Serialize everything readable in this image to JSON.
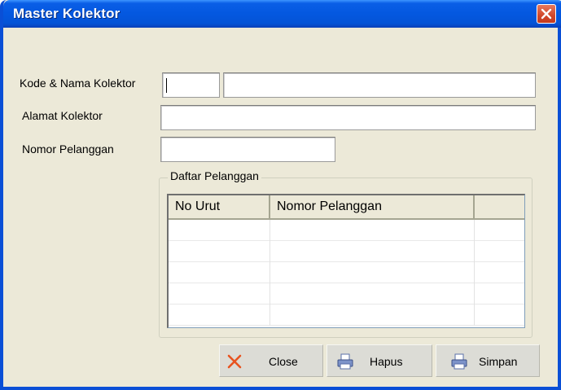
{
  "window": {
    "title": "Master Kolektor"
  },
  "form": {
    "kode_nama_label": "Kode & Nama Kolektor",
    "kode_value": "",
    "nama_value": "",
    "alamat_label": "Alamat Kolektor",
    "alamat_value": "",
    "nomor_pelanggan_label": "Nomor Pelanggan",
    "nomor_pelanggan_value": ""
  },
  "daftar": {
    "title": "Daftar Pelanggan",
    "columns": [
      "No Urut",
      "Nomor Pelanggan",
      ""
    ],
    "rows": [
      [
        "",
        "",
        ""
      ],
      [
        "",
        "",
        ""
      ],
      [
        "",
        "",
        ""
      ],
      [
        "",
        "",
        ""
      ],
      [
        "",
        "",
        ""
      ]
    ]
  },
  "buttons": {
    "close_label": "Close",
    "hapus_label": "Hapus",
    "simpan_label": "Simpan"
  },
  "icons": {
    "title_close": "close-icon",
    "close": "x-icon",
    "hapus": "printer-icon",
    "simpan": "printer-icon"
  },
  "colors": {
    "titlebar": "#0458e0",
    "window_bg": "#ece9d8",
    "close_button": "#d1472a",
    "close_x_icon": "#e8531f"
  }
}
